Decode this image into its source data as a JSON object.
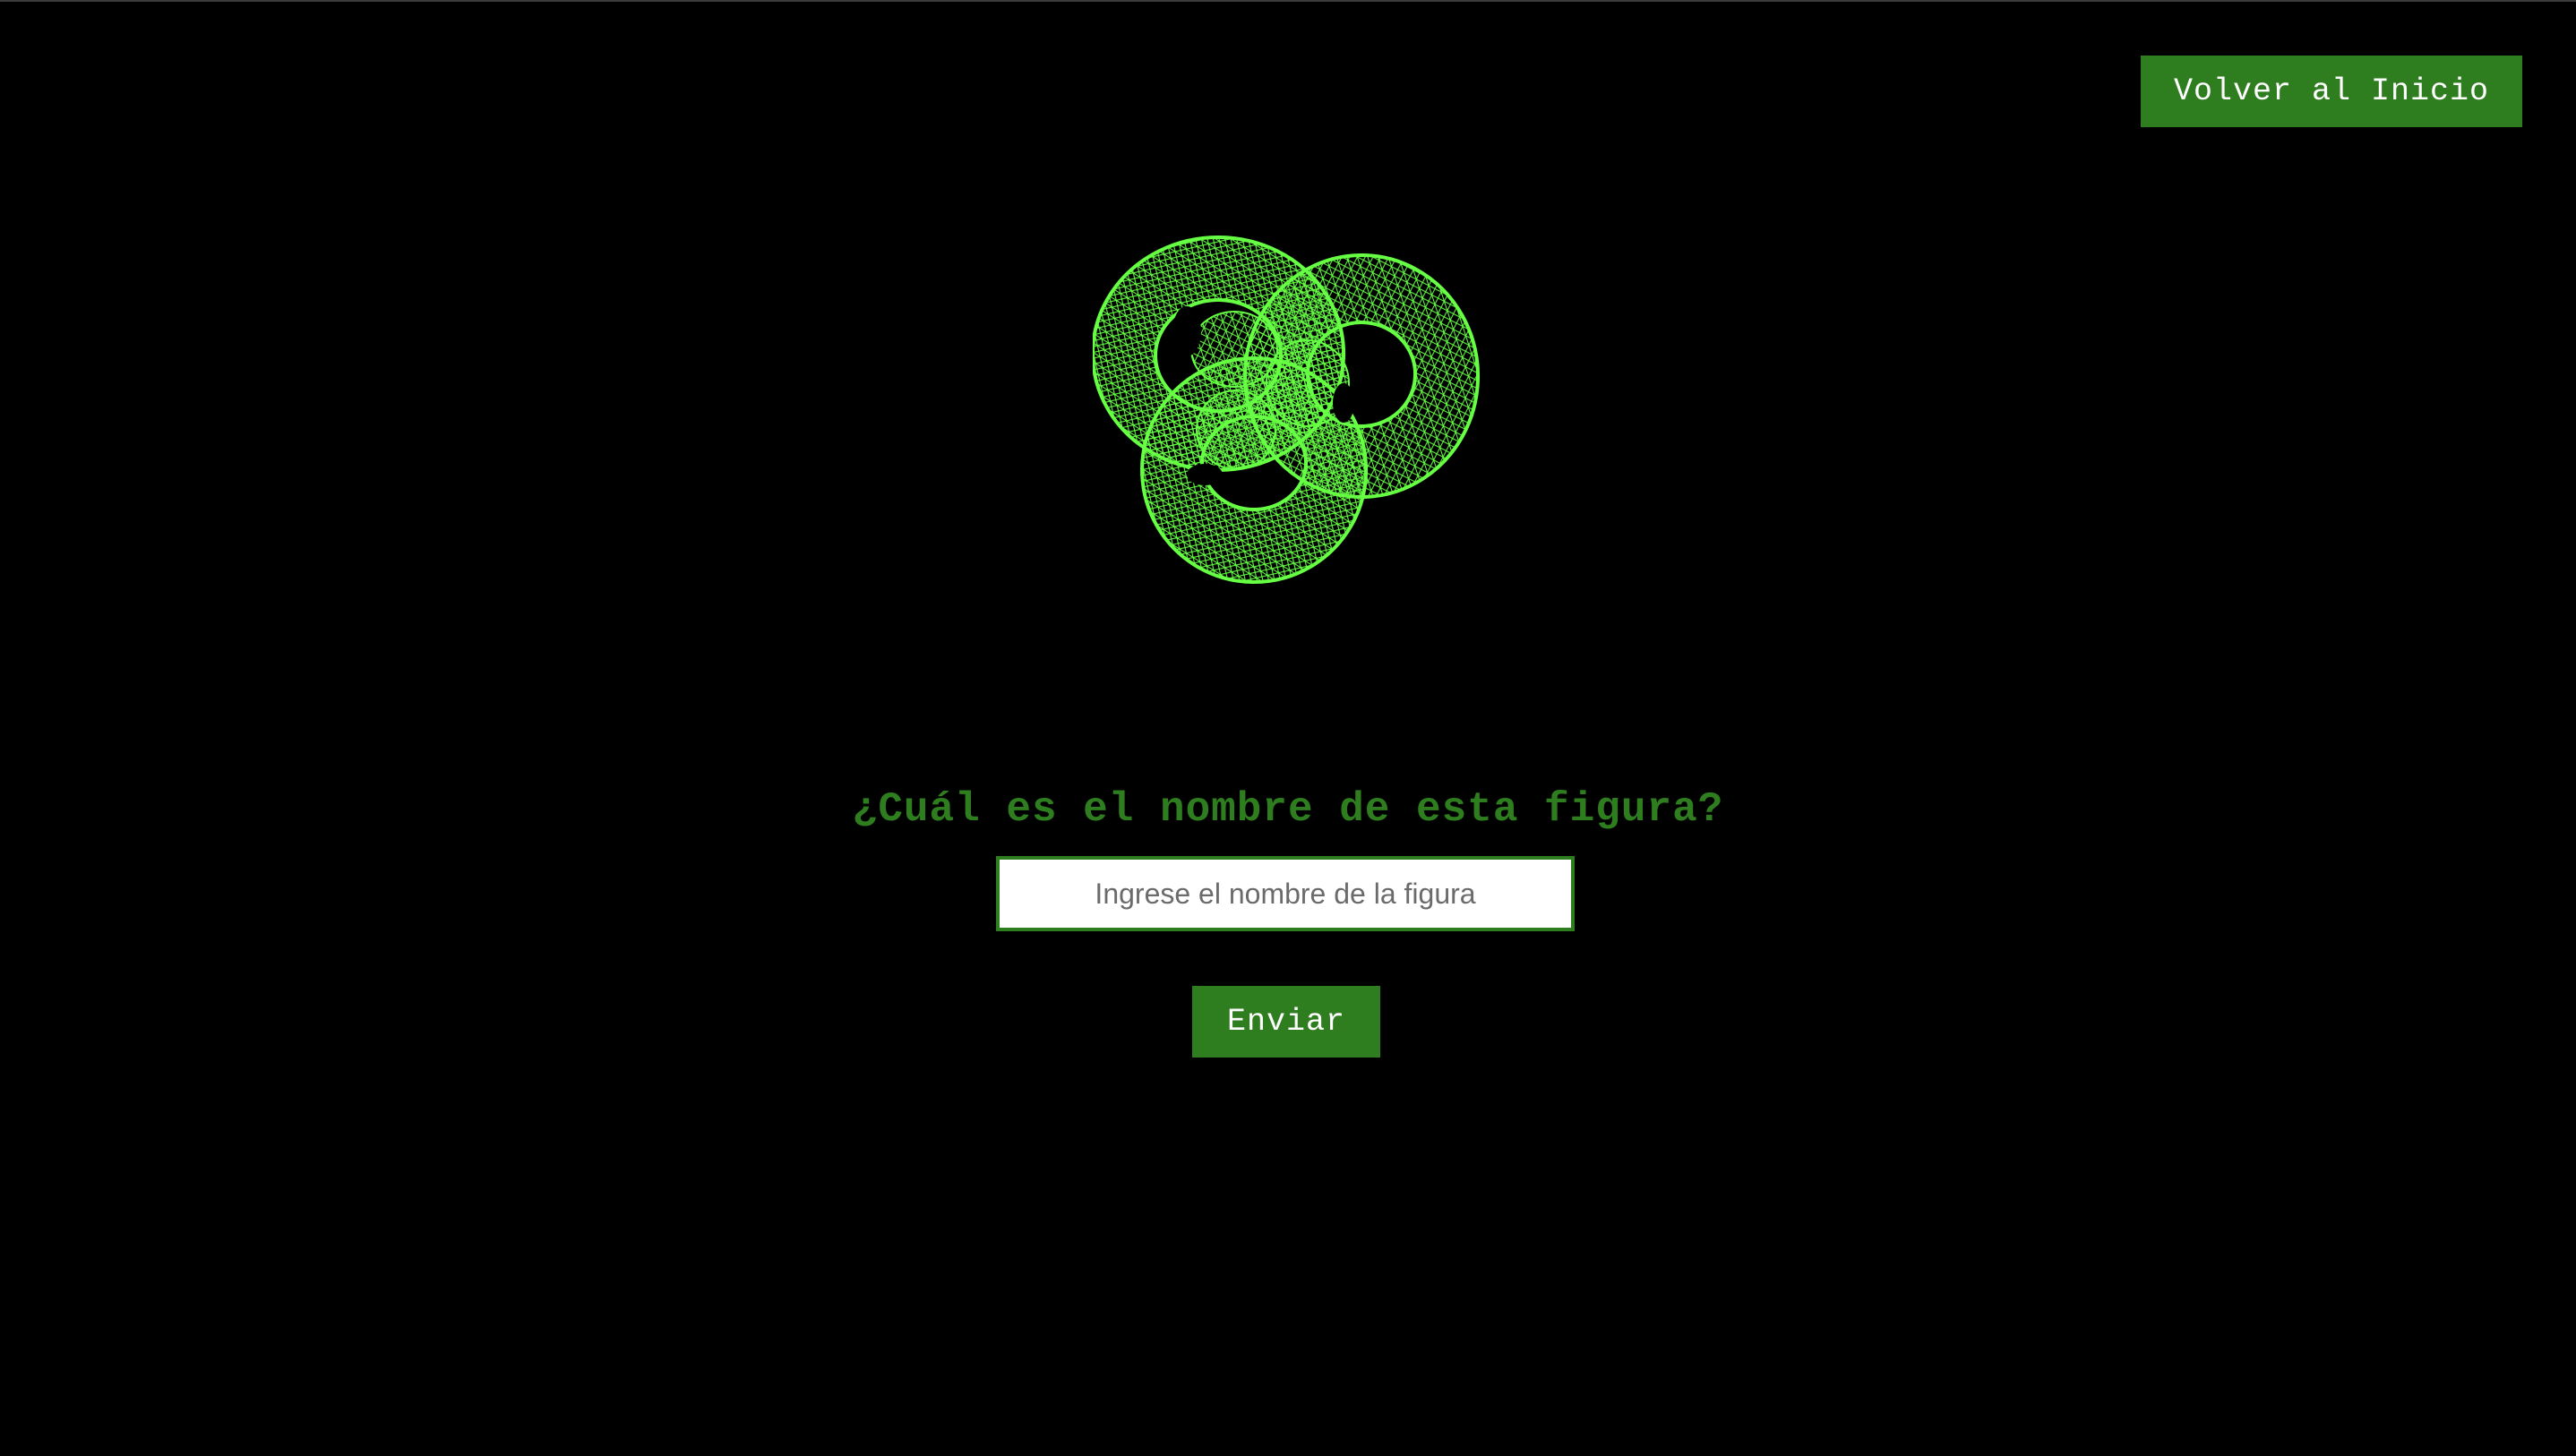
{
  "header": {
    "home_button_label": "Volver al Inicio"
  },
  "figure": {
    "icon": "wireframe-knot-figure",
    "color": "#66ff44"
  },
  "quiz": {
    "question": "¿Cuál es el nombre de esta figura?",
    "input_placeholder": "Ingrese el nombre de la figura",
    "input_value": "",
    "submit_label": "Enviar"
  },
  "theme": {
    "background": "#000000",
    "accent": "#2e7d1f",
    "button_text": "#ffffff"
  }
}
